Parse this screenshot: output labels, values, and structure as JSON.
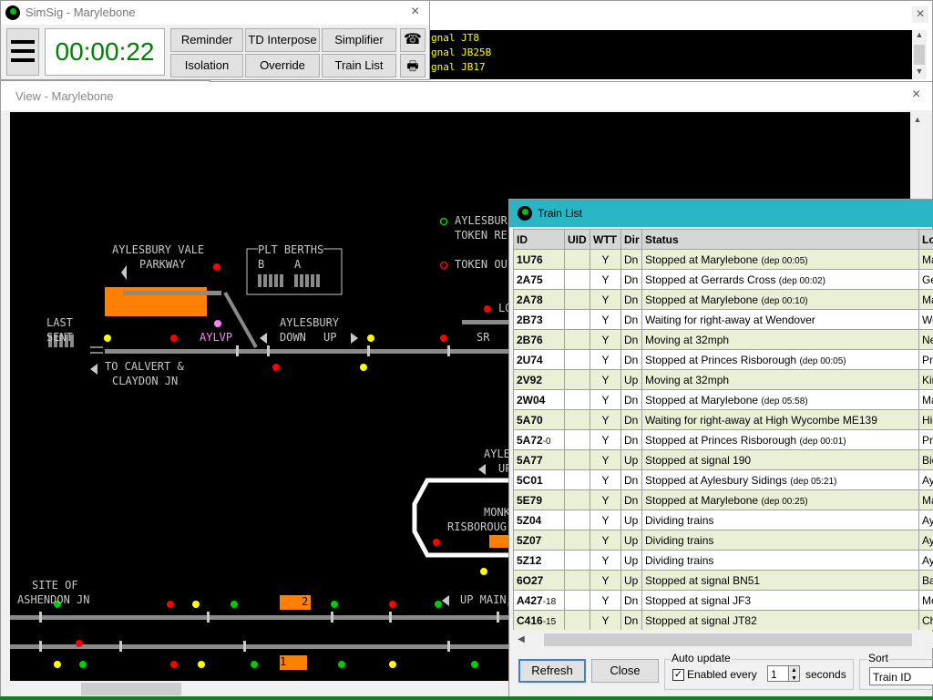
{
  "main_window": {
    "title": "SimSig - Marylebone",
    "clock": "00:00:22",
    "buttons": {
      "reminder": "Reminder",
      "td_interpose": "TD Interpose",
      "simplifier": "Simplifier",
      "isolation": "Isolation",
      "override": "Override",
      "train_list": "Train List"
    }
  },
  "message_log": {
    "lines": [
      "gnal JT8",
      "gnal JB25B",
      "gnal JB17"
    ]
  },
  "view_window": {
    "title": "View - Marylebone"
  },
  "diagram": {
    "labels": {
      "aylesbury_vale_1": "AYLESBURY VALE",
      "aylesbury_vale_2": "PARKWAY",
      "plt_berths": "PLT BERTHS",
      "plt_b": "B",
      "plt_a": "A",
      "last_sent_1": "LAST",
      "last_sent_2": "SENT",
      "aylvp": "AYLVP",
      "aylesbury": "AYLESBURY",
      "down": "DOWN",
      "up": "UP",
      "to_calvert_1": "TO CALVERT &",
      "to_calvert_2": "CLAYDON JN",
      "aylesbury_token_1": "AYLESBUR",
      "aylesbury_token_2": "TOKEN RE",
      "token_out": "TOKEN OU",
      "sr": "SR",
      "lo": "LO",
      "ayle": "AYLE",
      "up2": "UP",
      "monk": "MONK",
      "risborough": "RISBOROUG",
      "site_of_1": "SITE OF",
      "site_of_2": "ASHENDON JN",
      "up_main": "UP MAIN",
      "berth_2": "2",
      "berth_1": "1"
    }
  },
  "train_list": {
    "title": "Train List",
    "columns": [
      "ID",
      "UID",
      "WTT",
      "Dir",
      "Status",
      "Lo"
    ],
    "rows": [
      {
        "id": "1U76",
        "id_suffix": "",
        "uid": "",
        "wtt": "Y",
        "dir": "Dn",
        "status": "Stopped at Marylebone",
        "dep": "(dep 00:05)",
        "loc": "Ma"
      },
      {
        "id": "2A75",
        "id_suffix": "",
        "uid": "",
        "wtt": "Y",
        "dir": "Dn",
        "status": "Stopped at Gerrards Cross",
        "dep": "(dep 00:02)",
        "loc": "Ge"
      },
      {
        "id": "2A78",
        "id_suffix": "",
        "uid": "",
        "wtt": "Y",
        "dir": "Dn",
        "status": "Stopped at Marylebone",
        "dep": "(dep 00:10)",
        "loc": "Ma"
      },
      {
        "id": "2B73",
        "id_suffix": "",
        "uid": "",
        "wtt": "Y",
        "dir": "Dn",
        "status": "Waiting for right-away at Wendover",
        "dep": "",
        "loc": "We"
      },
      {
        "id": "2B76",
        "id_suffix": "",
        "uid": "",
        "wtt": "Y",
        "dir": "Dn",
        "status": "Moving at 32mph",
        "dep": "",
        "loc": "Ne"
      },
      {
        "id": "2U74",
        "id_suffix": "",
        "uid": "",
        "wtt": "Y",
        "dir": "Dn",
        "status": "Stopped at Princes Risborough",
        "dep": "(dep 00:05)",
        "loc": "Pri"
      },
      {
        "id": "2V92",
        "id_suffix": "",
        "uid": "",
        "wtt": "Y",
        "dir": "Up",
        "status": "Moving at 32mph",
        "dep": "",
        "loc": "Kin"
      },
      {
        "id": "2W04",
        "id_suffix": "",
        "uid": "",
        "wtt": "Y",
        "dir": "Dn",
        "status": "Stopped at Marylebone",
        "dep": "(dep 05:58)",
        "loc": "Ma"
      },
      {
        "id": "5A70",
        "id_suffix": "",
        "uid": "",
        "wtt": "Y",
        "dir": "Dn",
        "status": "Waiting for right-away at High Wycombe ME139",
        "dep": "",
        "loc": "Hig"
      },
      {
        "id": "5A72",
        "id_suffix": "-0",
        "uid": "",
        "wtt": "Y",
        "dir": "Dn",
        "status": "Stopped at Princes Risborough",
        "dep": "(dep 00:01)",
        "loc": "Pri"
      },
      {
        "id": "5A77",
        "id_suffix": "",
        "uid": "",
        "wtt": "Y",
        "dir": "Up",
        "status": "Stopped at signal 190",
        "dep": "",
        "loc": "Bic"
      },
      {
        "id": "5C01",
        "id_suffix": "",
        "uid": "",
        "wtt": "Y",
        "dir": "Dn",
        "status": "Stopped at Aylesbury Sidings",
        "dep": "(dep 05:21)",
        "loc": "Ayl"
      },
      {
        "id": "5E79",
        "id_suffix": "",
        "uid": "",
        "wtt": "Y",
        "dir": "Dn",
        "status": "Stopped at Marylebone",
        "dep": "(dep 00:25)",
        "loc": "Ma"
      },
      {
        "id": "5Z04",
        "id_suffix": "",
        "uid": "",
        "wtt": "Y",
        "dir": "Up",
        "status": "Dividing trains",
        "dep": "",
        "loc": "Ayl"
      },
      {
        "id": "5Z07",
        "id_suffix": "",
        "uid": "",
        "wtt": "Y",
        "dir": "Up",
        "status": "Dividing trains",
        "dep": "",
        "loc": "Ayl"
      },
      {
        "id": "5Z12",
        "id_suffix": "",
        "uid": "",
        "wtt": "Y",
        "dir": "Up",
        "status": "Dividing trains",
        "dep": "",
        "loc": "Ayl"
      },
      {
        "id": "6O27",
        "id_suffix": "",
        "uid": "",
        "wtt": "Y",
        "dir": "Up",
        "status": "Stopped at signal BN51",
        "dep": "",
        "loc": "Ba"
      },
      {
        "id": "A427",
        "id_suffix": "-18",
        "uid": "",
        "wtt": "Y",
        "dir": "Dn",
        "status": "Stopped at signal JF3",
        "dep": "",
        "loc": "Mo"
      },
      {
        "id": "C416",
        "id_suffix": "-15",
        "uid": "",
        "wtt": "Y",
        "dir": "Dn",
        "status": "Stopped at signal JT82",
        "dep": "",
        "loc": "Ch"
      }
    ],
    "buttons": {
      "refresh": "Refresh",
      "close": "Close"
    },
    "auto_update": {
      "label": "Auto update",
      "enabled_label": "Enabled every",
      "enabled": true,
      "interval": "1",
      "seconds_label": "seconds"
    },
    "sort": {
      "label": "Sort",
      "value": "Train ID"
    }
  },
  "colors": {
    "clock_green": "#008000",
    "train_list_title": "#2ab5c4",
    "diagram_bg": "#000000",
    "track_grey": "#8a8a8a",
    "berth_orange": "#ff8000",
    "signal_red": "#ff0000",
    "signal_green": "#00cc00",
    "signal_yellow": "#ffff00",
    "aylvp_pink": "#ff80ff"
  }
}
